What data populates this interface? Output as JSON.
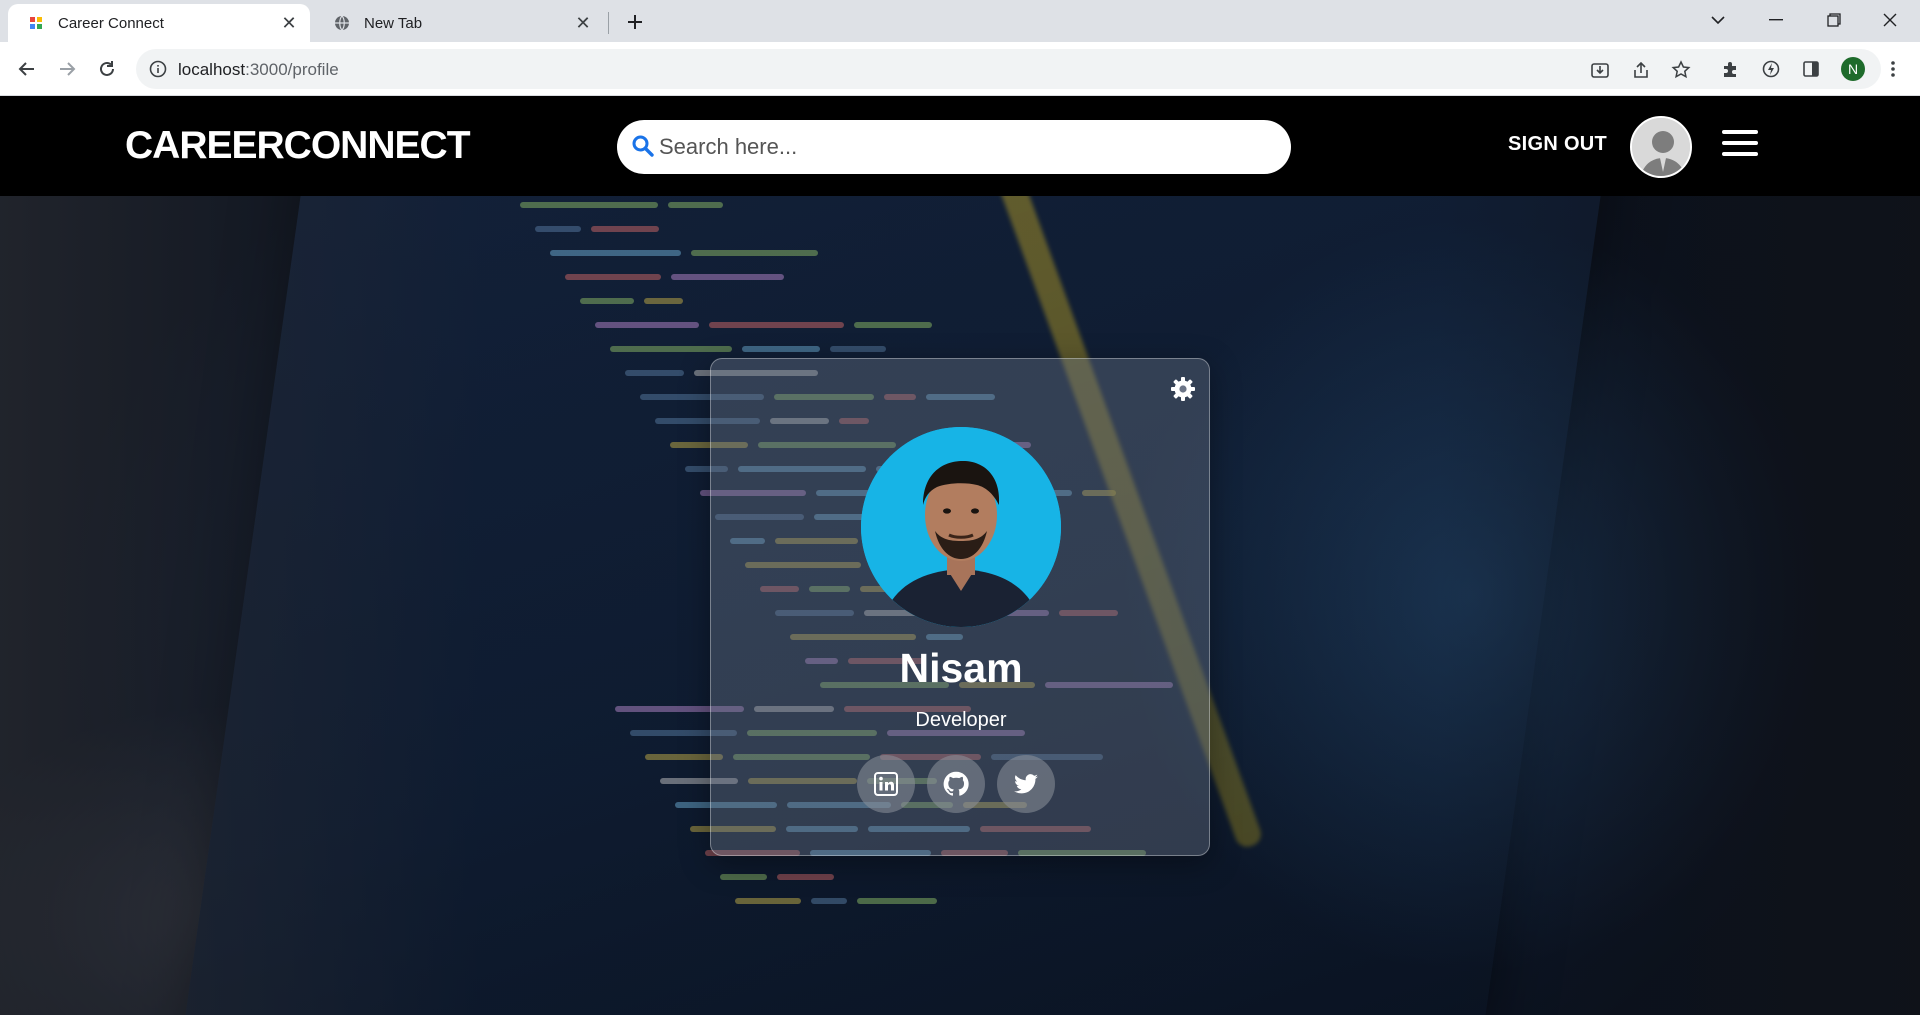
{
  "browser": {
    "tabs": [
      {
        "title": "Career Connect",
        "active": true
      },
      {
        "title": "New Tab",
        "active": false
      }
    ],
    "url_host": "localhost",
    "url_path": ":3000/profile",
    "profile_initial": "N"
  },
  "header": {
    "brand": "CAREERCONNECT",
    "search_placeholder": "Search here...",
    "signout_label": "SIGN OUT"
  },
  "profile": {
    "name": "Nisam",
    "role": "Developer",
    "socials": [
      {
        "icon": "linkedin-icon"
      },
      {
        "icon": "github-icon"
      },
      {
        "icon": "twitter-icon"
      }
    ]
  },
  "colors": {
    "nav_bg": "#000000",
    "photo_bg": "#17b4e6",
    "search_icon": "#1a73e8"
  }
}
